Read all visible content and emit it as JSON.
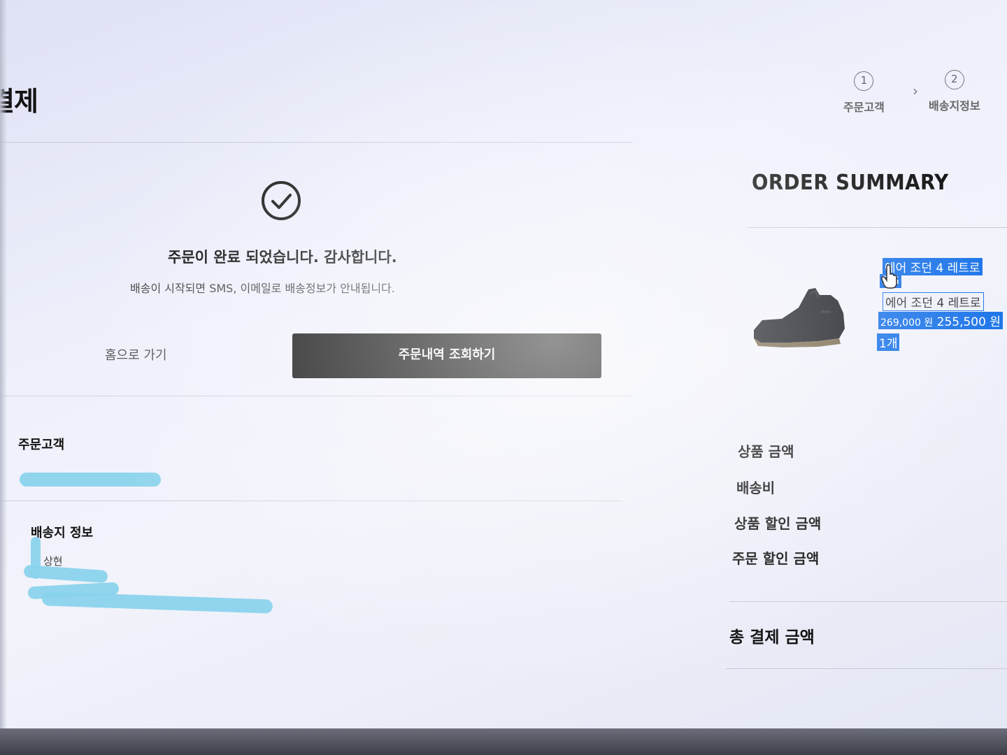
{
  "page": {
    "title": "결제"
  },
  "stepper": {
    "steps": [
      {
        "number": "1",
        "label": "주문고객"
      },
      {
        "number": "2",
        "label": "배송지정보"
      }
    ]
  },
  "confirmation": {
    "title": "주문이 완료 되었습니다. 감사합니다.",
    "subtitle": "배송이 시작되면 SMS, 이메일로 배송정보가 안내됩니다.",
    "home_link": "홈으로 가기",
    "order_history_button": "주문내역 조회하기"
  },
  "customer": {
    "label": "주문고객"
  },
  "shipping": {
    "label": "배송지 정보",
    "name_partial": "상현"
  },
  "summary": {
    "title": "ORDER SUMMARY",
    "item": {
      "name_line1": "에어 조던 4 레트로",
      "name_line2": "RG",
      "name_line3": "에어 조던 4 레트로",
      "price_original": "269,000 원",
      "price_sale": "255,500 원",
      "quantity": "1개"
    },
    "rows": {
      "product_amount": "상품 금액",
      "shipping_fee": "배송비",
      "product_discount": "상품 할인 금액",
      "order_discount": "주문 할인 금액",
      "total": "총 결제 금액"
    }
  },
  "colors": {
    "button_bg": "#111111",
    "selection": "#1a73e8",
    "redaction": "#8ad3ec"
  }
}
